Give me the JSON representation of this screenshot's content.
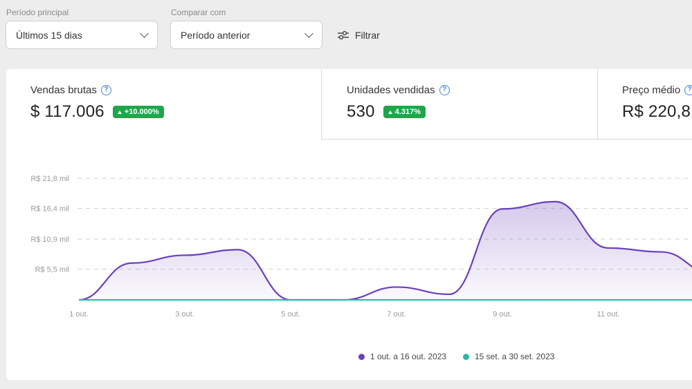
{
  "filters": {
    "main_period": {
      "label": "Período principal",
      "value": "Últimos 15 dias"
    },
    "compare": {
      "label": "Comparar com",
      "value": "Período anterior"
    },
    "filter_button": "Filtrar"
  },
  "kpis": [
    {
      "title": "Vendas brutas",
      "value": "$ 117.006",
      "delta": "+10.000%"
    },
    {
      "title": "Unidades vendidas",
      "value": "530",
      "delta": "4.317%"
    },
    {
      "title": "Preço médio",
      "value": "R$ 220,8"
    }
  ],
  "colors": {
    "current": "#6a3fbb",
    "previous": "#2bb6a8",
    "badge": "#1fa64b"
  },
  "chart_data": {
    "type": "area",
    "y_tick_labels": [
      "R$ 5,5 mil",
      "R$ 10,9 mil",
      "R$ 16,4 mil",
      "R$ 21,8 mil"
    ],
    "y_ticks": [
      5.5,
      10.9,
      16.4,
      21.8
    ],
    "ylim": [
      0,
      21.8
    ],
    "x_tick_labels": [
      "1 out.",
      "3 out.",
      "5 out.",
      "7 out.",
      "9 out.",
      "11 out."
    ],
    "x_tick_index": [
      0,
      2,
      4,
      6,
      8,
      10
    ],
    "grid": true,
    "series": [
      {
        "name": "1 out. a 16 out. 2023",
        "values": [
          0,
          6.6,
          8.0,
          9.0,
          0,
          0,
          2.3,
          1.0,
          16.3,
          17.6,
          9.3,
          8.6,
          4.5
        ]
      },
      {
        "name": "15 set. a 30 set. 2023",
        "values": [
          0,
          0,
          0,
          0,
          0,
          0,
          0,
          0,
          0,
          0,
          0,
          0,
          0
        ]
      }
    ]
  }
}
